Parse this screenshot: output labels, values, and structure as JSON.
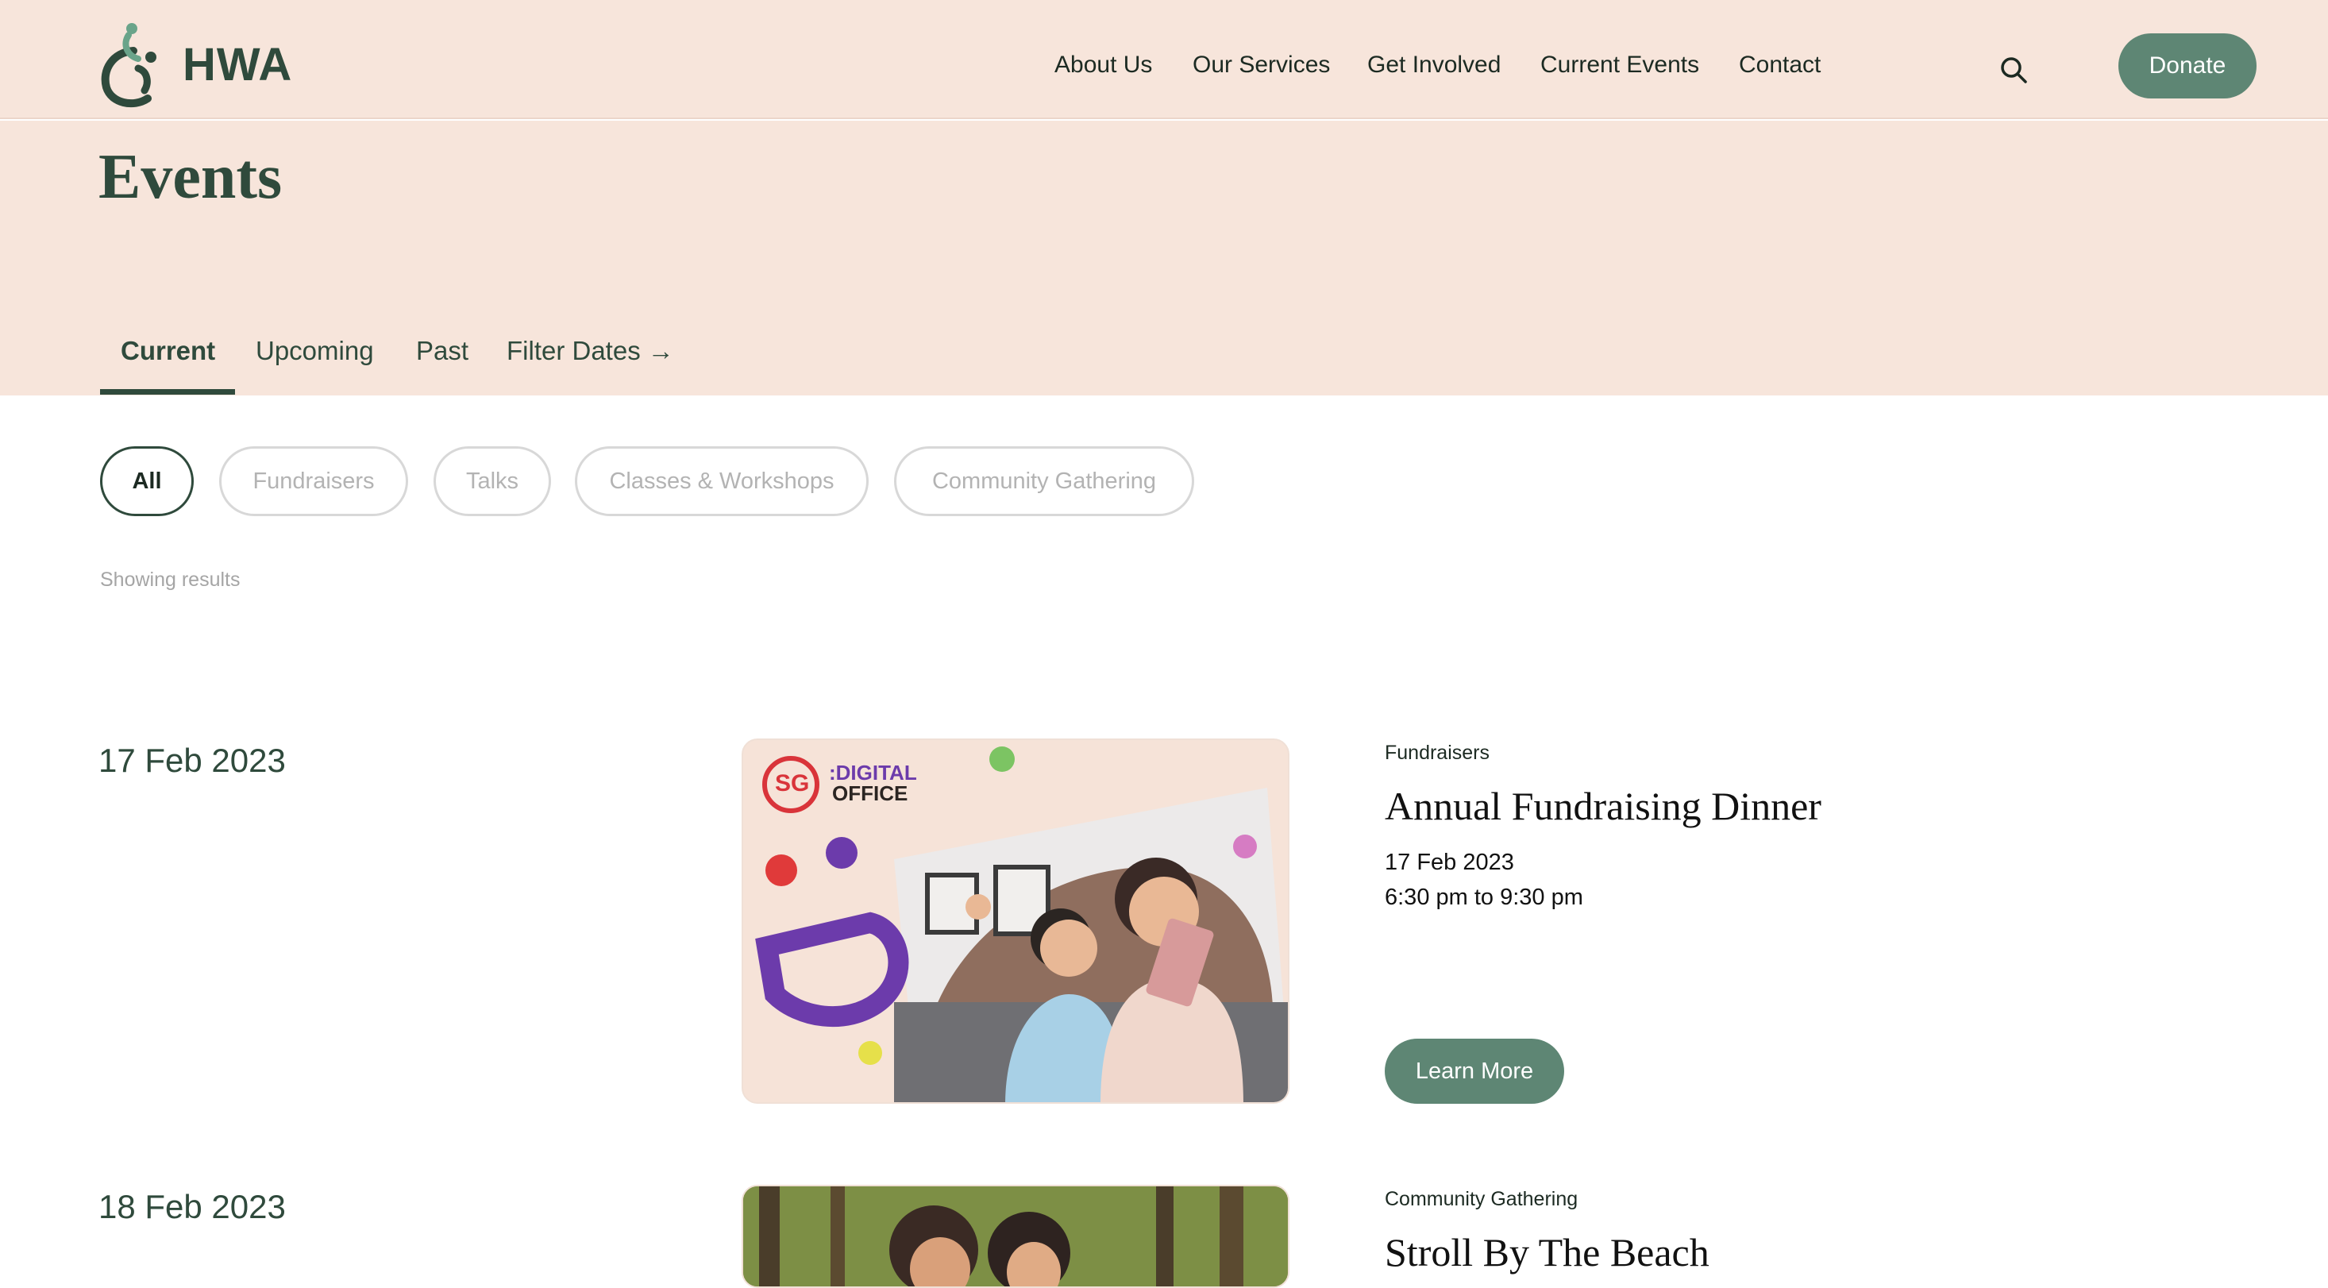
{
  "header": {
    "logo_text": "HWA",
    "nav": [
      "About Us",
      "Our Services",
      "Get Involved",
      "Current Events",
      "Contact"
    ],
    "search_icon": "search-icon",
    "donate_label": "Donate"
  },
  "page": {
    "title": "Events",
    "tabs": [
      "Current",
      "Upcoming",
      "Past",
      "Filter Dates"
    ],
    "active_tab": "Current",
    "filter_arrow": "→",
    "chips": [
      "All",
      "Fundraisers",
      "Talks",
      "Classes & Workshops",
      "Community Gathering"
    ],
    "active_chip": "All",
    "results_text": "Showing results"
  },
  "events": [
    {
      "date": "17 Feb 2023",
      "category": "Fundraisers",
      "title": "Annual Fundraising Dinner",
      "date_line": "17 Feb 2023",
      "time_line": "6:30 pm to 9:30 pm",
      "button": "Learn More",
      "image_brand_a": "SG",
      "image_brand_b": ":DIGITAL",
      "image_brand_c": "OFFICE"
    },
    {
      "date": "18 Feb 2023",
      "category": "Community Gathering",
      "title": "Stroll By The Beach"
    }
  ],
  "colors": {
    "accent": "#5e8674",
    "hero_bg": "#f7e5db",
    "text_dark": "#2f4a3c"
  }
}
